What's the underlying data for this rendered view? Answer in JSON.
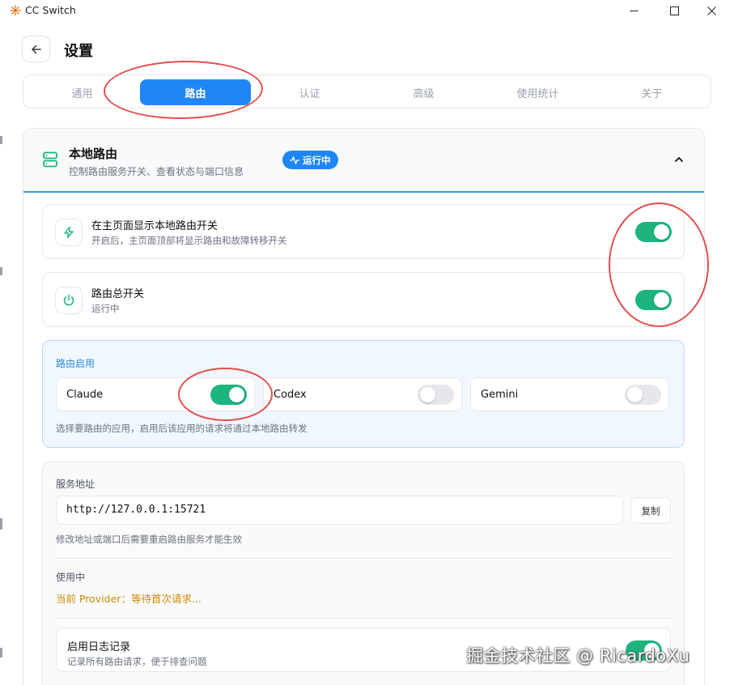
{
  "window": {
    "title": "CC Switch"
  },
  "header": {
    "title": "设置"
  },
  "tabs": [
    {
      "label": "通用",
      "active": false
    },
    {
      "label": "路由",
      "active": true
    },
    {
      "label": "认证",
      "active": false
    },
    {
      "label": "高级",
      "active": false
    },
    {
      "label": "使用统计",
      "active": false
    },
    {
      "label": "关于",
      "active": false
    }
  ],
  "section": {
    "title": "本地路由",
    "subtitle": "控制路由服务开关、查看状态与端口信息",
    "status": "运行中"
  },
  "rows": {
    "show_switch": {
      "title": "在主页面显示本地路由开关",
      "desc": "开启后，主页面顶部将显示路由和故障转移开关",
      "enabled": true
    },
    "master": {
      "title": "路由总开关",
      "desc": "运行中",
      "enabled": true
    }
  },
  "apps": {
    "label": "路由启用",
    "items": [
      {
        "name": "Claude",
        "enabled": true
      },
      {
        "name": "Codex",
        "enabled": false
      },
      {
        "name": "Gemini",
        "enabled": false
      }
    ],
    "note": "选择要路由的应用，启用后该应用的请求将通过本地路由转发"
  },
  "service": {
    "label": "服务地址",
    "address": "http://127.0.0.1:15721",
    "copy_label": "复制",
    "hint": "修改地址或端口后需要重启路由服务才能生效",
    "in_use_label": "使用中",
    "provider_line": "当前 Provider：等待首次请求...",
    "log": {
      "title": "启用日志记录",
      "desc": "记录所有路由请求，便于排查问题",
      "enabled": true
    }
  },
  "watermark": "掘金技术社区 @ RicardoXu",
  "colors": {
    "accent": "#1f87f5",
    "toggle_on": "#1db47e",
    "warning_text": "#c98a06",
    "annotation": "#e0504f"
  }
}
